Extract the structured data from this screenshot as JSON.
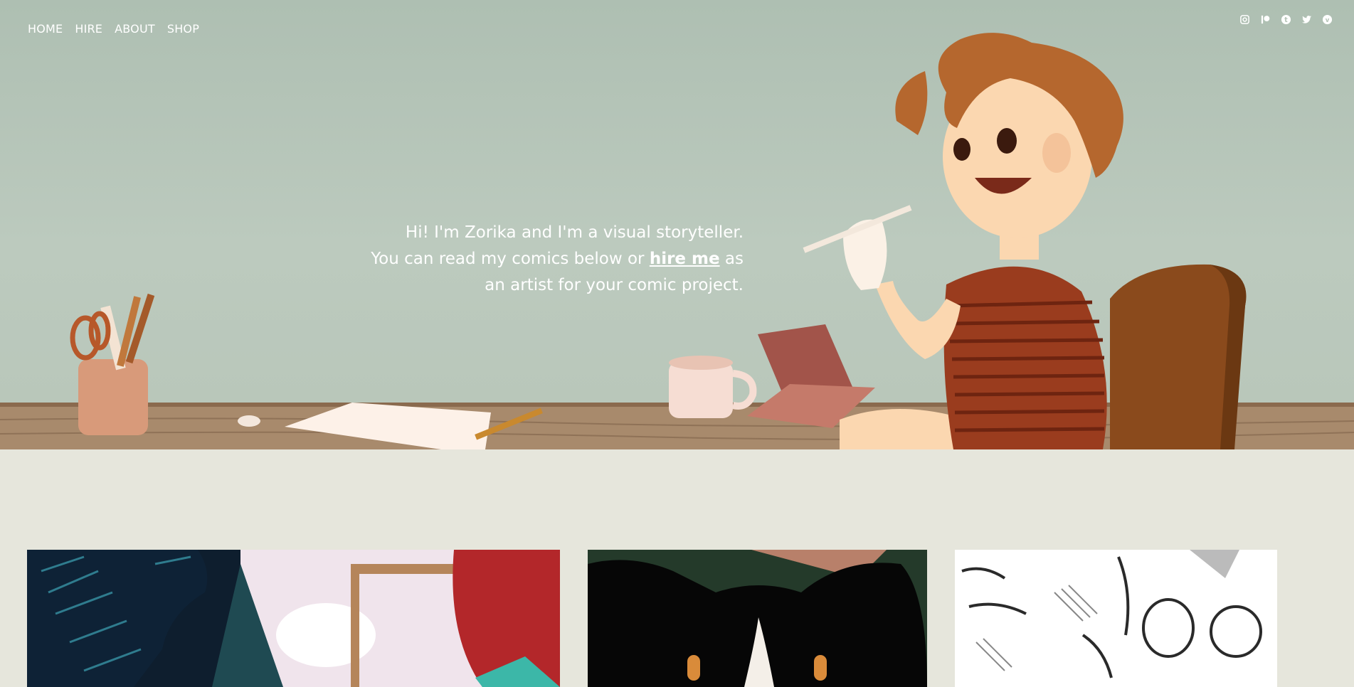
{
  "nav": {
    "items": [
      {
        "label": "HOME"
      },
      {
        "label": "HIRE"
      },
      {
        "label": "ABOUT"
      },
      {
        "label": "SHOP"
      }
    ]
  },
  "social": {
    "icons": [
      "instagram-icon",
      "patreon-icon",
      "tumblr-icon",
      "twitter-icon",
      "vimeo-icon"
    ]
  },
  "intro": {
    "line1": "Hi! I'm Zorika and I'm a visual storyteller.",
    "line2_before": "You can read my comics below or ",
    "line2_link": "hire me",
    "line2_after": " as",
    "line3": "an artist for your comic project."
  },
  "colors": {
    "hero_bg": "#b4c3b6",
    "page_bg": "#e6e6dc",
    "desk": "#a88868",
    "shirt": "#9a3c1e",
    "hair": "#b5672e",
    "chair": "#8a4a1c"
  },
  "comics": [
    {
      "name": "comic-thumb-winter-forest"
    },
    {
      "name": "comic-thumb-black-cat"
    },
    {
      "name": "comic-thumb-sketch-faces"
    }
  ]
}
